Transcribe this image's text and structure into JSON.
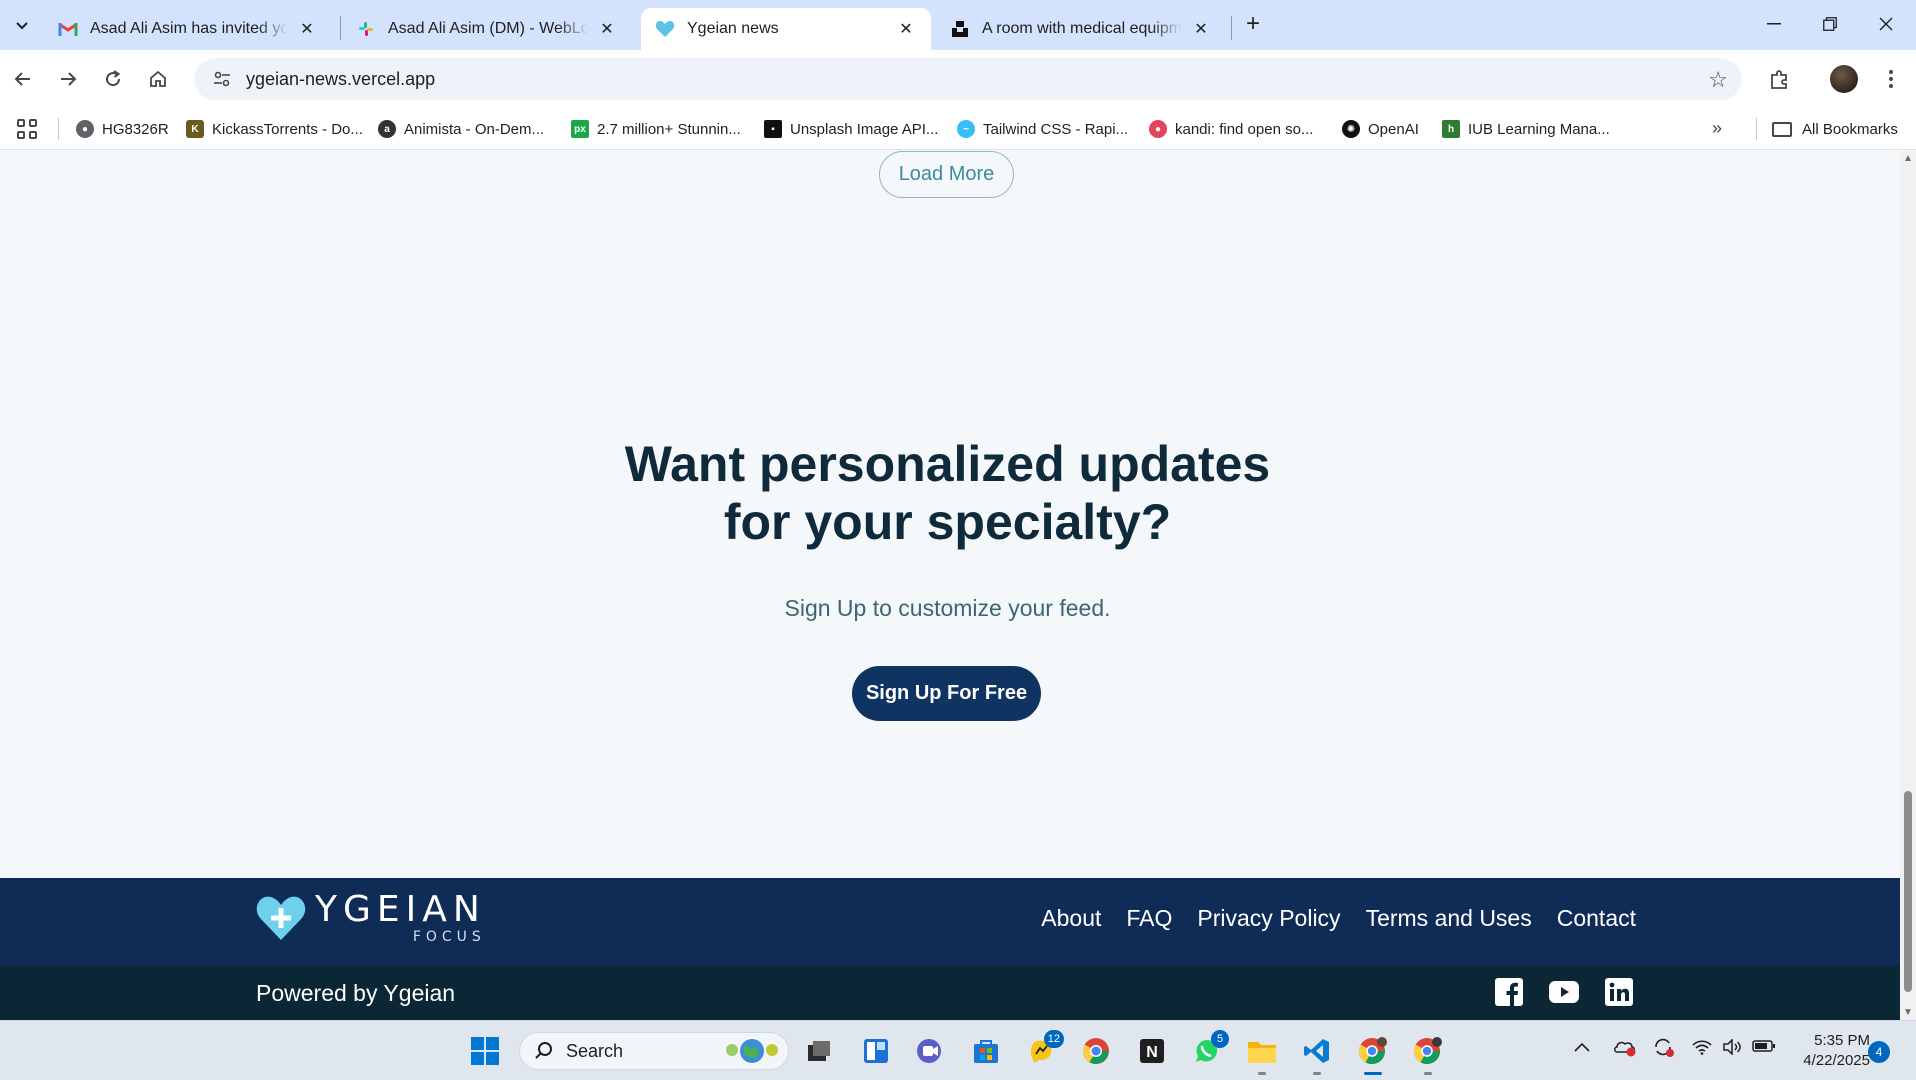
{
  "browser": {
    "tabs": [
      {
        "title": "Asad Ali Asim has invited you to",
        "icon": "gmail-icon",
        "active": false
      },
      {
        "title": "Asad Ali Asim (DM) - WebLoop",
        "icon": "slack-icon",
        "active": false
      },
      {
        "title": "Ygeian news",
        "icon": "ygeian-heart-icon",
        "active": true
      },
      {
        "title": "A room with medical equipment",
        "icon": "unsplash-icon",
        "active": false
      }
    ],
    "url": "ygeian-news.vercel.app",
    "bookmarks": [
      {
        "label": "HG8326R",
        "color": "#5f6368"
      },
      {
        "label": "KickassTorrents - Do...",
        "color": "#6b5a1e"
      },
      {
        "label": "Animista - On-Dem...",
        "color": "#333333"
      },
      {
        "label": "2.7 million+ Stunnin...",
        "color": "#1aa84a"
      },
      {
        "label": "Unsplash Image API...",
        "color": "#111111"
      },
      {
        "label": "Tailwind CSS - Rapi...",
        "color": "#38bdf8"
      },
      {
        "label": "kandi: find open so...",
        "color": "#e2455a"
      },
      {
        "label": "OpenAI",
        "color": "#111111"
      },
      {
        "label": "IUB Learning Mana...",
        "color": "#2e7d32"
      }
    ],
    "all_bookmarks_label": "All Bookmarks"
  },
  "page": {
    "load_more_label": "Load More",
    "cta": {
      "title_line1": "Want personalized updates",
      "title_line2": "for your specialty?",
      "subtitle": "Sign Up to customize your feed.",
      "button_label": "Sign Up For Free"
    },
    "footer": {
      "logo_text": "YGEIAN",
      "logo_subtext": "FOCUS",
      "links": [
        "About",
        "FAQ",
        "Privacy Policy",
        "Terms and Uses",
        "Contact"
      ],
      "powered_by": "Powered by Ygeian",
      "social": [
        "facebook-icon",
        "youtube-icon",
        "linkedin-icon"
      ]
    }
  },
  "taskbar": {
    "search_label": "Search",
    "badges": {
      "messenger": "12",
      "whatsapp": "5"
    },
    "time": "5:35 PM",
    "date": "4/22/2025",
    "notifications": "4"
  },
  "colors": {
    "footer_top": "#0f2c57",
    "footer_bottom": "#0b2736",
    "signup_button": "#103461",
    "heading": "#0f2a3a",
    "load_more_accent": "#3c8aa0"
  }
}
